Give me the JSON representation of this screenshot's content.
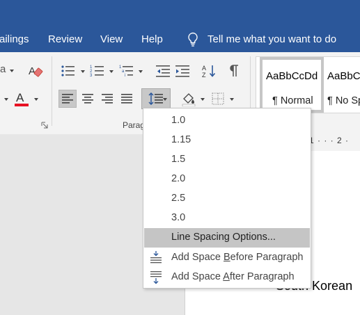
{
  "tabs": [
    "ailings",
    "Review",
    "View",
    "Help"
  ],
  "tell_me": "Tell me what you want to do",
  "ribbon": {
    "paragraph_group_label": "Parag",
    "styles": [
      {
        "preview": "AaBbCcDd",
        "name": "¶ Normal"
      },
      {
        "preview": "AaBbC",
        "name": "¶ No Sp"
      }
    ]
  },
  "menu": {
    "items": [
      "1.0",
      "1.15",
      "1.5",
      "2.0",
      "2.5",
      "3.0",
      "Line Spacing Options..."
    ],
    "add_before": {
      "pre": "Add Space ",
      "key": "B",
      "post": "efore Paragraph"
    },
    "add_after": {
      "pre": "Add Space ",
      "key": "A",
      "post": "fter Paragraph"
    }
  },
  "ruler": "1 · · · 2 ·",
  "document_text": "South Korean",
  "colors": {
    "brand": "#2b579a",
    "font_color_red": "#e81123",
    "menu_highlight": "#c5c5c5"
  },
  "icons": [
    "lightbulb-icon",
    "bullets-icon",
    "numbering-icon",
    "multilevel-list-icon",
    "decrease-indent-icon",
    "increase-indent-icon",
    "sort-icon",
    "pilcrow-icon",
    "align-left-icon",
    "center-icon",
    "align-right-icon",
    "justify-icon",
    "line-spacing-icon",
    "shading-icon",
    "borders-icon",
    "clear-formatting-icon",
    "font-color-icon",
    "dialog-launcher-icon"
  ]
}
